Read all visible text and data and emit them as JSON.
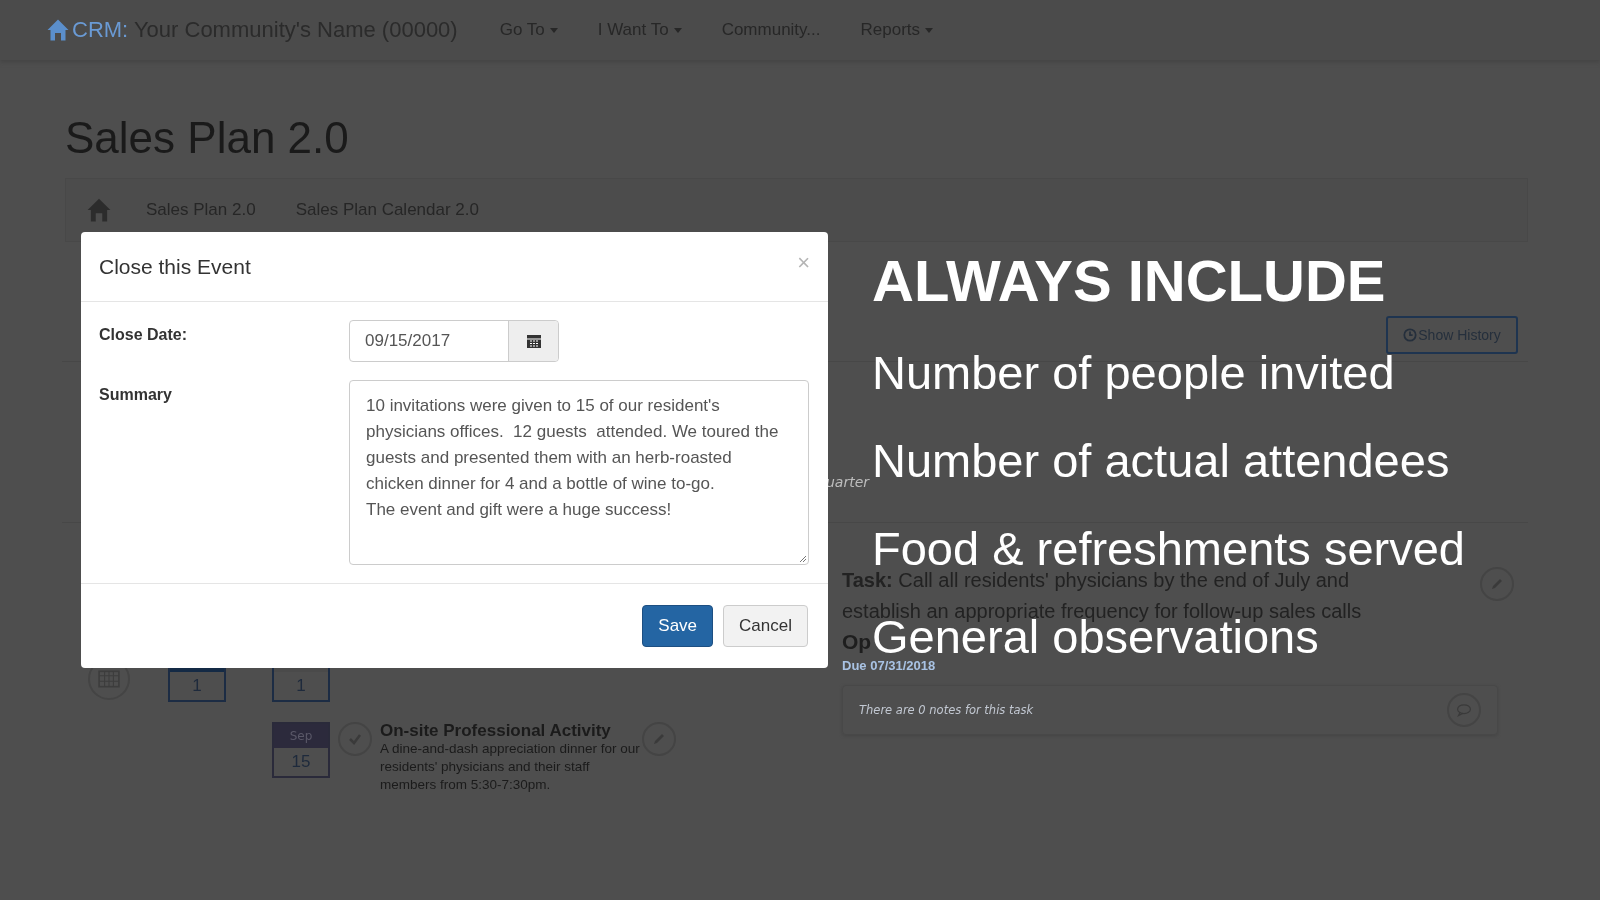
{
  "nav": {
    "brand_prefix": "CRM:",
    "brand_name": "Your Community's Name (00000)",
    "menus": [
      {
        "label": "Go To",
        "dropdown": true
      },
      {
        "label": "I Want To",
        "dropdown": true
      },
      {
        "label": "Community...",
        "dropdown": false
      },
      {
        "label": "Reports",
        "dropdown": true
      }
    ]
  },
  "page_title": "Sales Plan 2.0",
  "breadcrumbs": [
    "Sales Plan 2.0",
    "Sales Plan Calendar 2.0"
  ],
  "show_history": "Show History",
  "partial_text": "uarter",
  "calendar": {
    "dates": [
      {
        "day": "1",
        "highlight": true
      },
      {
        "day": "1",
        "highlight": false
      }
    ],
    "event": {
      "month": "Sep",
      "day": "15",
      "title": "On-site Professional Activity",
      "description": "A dine-and-dash appreciation dinner for our residents' physicians and their staff members from 5:30-7:30pm."
    }
  },
  "task": {
    "label": "Task:",
    "text": "Call all residents' physicians by the end of July and establish an appropriate frequency for follow-up sales calls",
    "status": "Op",
    "due": "Due 07/31/2018",
    "notes": "There are 0 notes for this task"
  },
  "modal": {
    "title": "Close this Event",
    "close": "×",
    "fields": [
      {
        "kind": "date",
        "label": "Close Date:",
        "value": "09/15/2017"
      },
      {
        "kind": "textarea",
        "label": "Summary",
        "value": "10 invitations were given to 15 of our resident's physicians offices.  12 guests  attended. We toured the guests and presented them with an herb-roasted chicken dinner for 4 and a bottle of wine to-go.\nThe event and gift were a huge success!"
      }
    ],
    "buttons": [
      {
        "label": "Save",
        "primary": true
      },
      {
        "label": "Cancel",
        "primary": false
      }
    ]
  },
  "overlay": {
    "heading": "ALWAYS INCLUDE",
    "items": [
      "Number of people invited",
      "Number of actual attendees",
      "Food & refreshments served",
      "General observations"
    ]
  }
}
